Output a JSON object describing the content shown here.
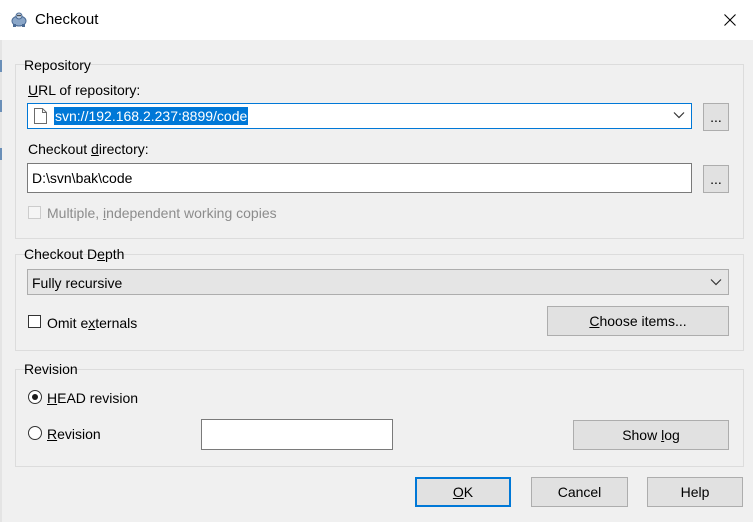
{
  "window": {
    "title": "Checkout",
    "icon": "tortoise-svn-icon",
    "close_icon": "close-icon"
  },
  "repository": {
    "group_title": "Repository",
    "url_label_prefix": "U",
    "url_label_rest": "RL of repository:",
    "url_value": "svn://192.168.2.237:8899/code",
    "browse_url_label": "...",
    "dir_label_prefix": "Checkout ",
    "dir_label_accel": "d",
    "dir_label_rest": "irectory:",
    "dir_value": "D:\\svn\\bak\\code",
    "browse_dir_label": "...",
    "multiple_prefix": "Multiple, ",
    "multiple_accel": "i",
    "multiple_rest": "ndependent working copies",
    "multiple_checked": false,
    "multiple_enabled": false
  },
  "depth": {
    "group_title_prefix": "Checkout D",
    "group_title_accel": "e",
    "group_title_rest": "pth",
    "selected": "Fully recursive",
    "omit_prefix": "Omit e",
    "omit_accel": "x",
    "omit_rest": "ternals",
    "omit_checked": false,
    "choose_prefix": "",
    "choose_accel": "C",
    "choose_rest": "hoose items..."
  },
  "revision": {
    "group_title": "Revision",
    "head_accel": "H",
    "head_rest": "EAD revision",
    "head_selected": true,
    "rev_accel": "R",
    "rev_rest": "evision",
    "rev_selected": false,
    "rev_value": "",
    "showlog_prefix": "Show ",
    "showlog_accel": "l",
    "showlog_rest": "og"
  },
  "buttons": {
    "ok_accel": "O",
    "ok_rest": "K",
    "cancel": "Cancel",
    "help": "Help"
  },
  "colors": {
    "accent": "#0078d7",
    "selection_text": "#ffffff"
  }
}
